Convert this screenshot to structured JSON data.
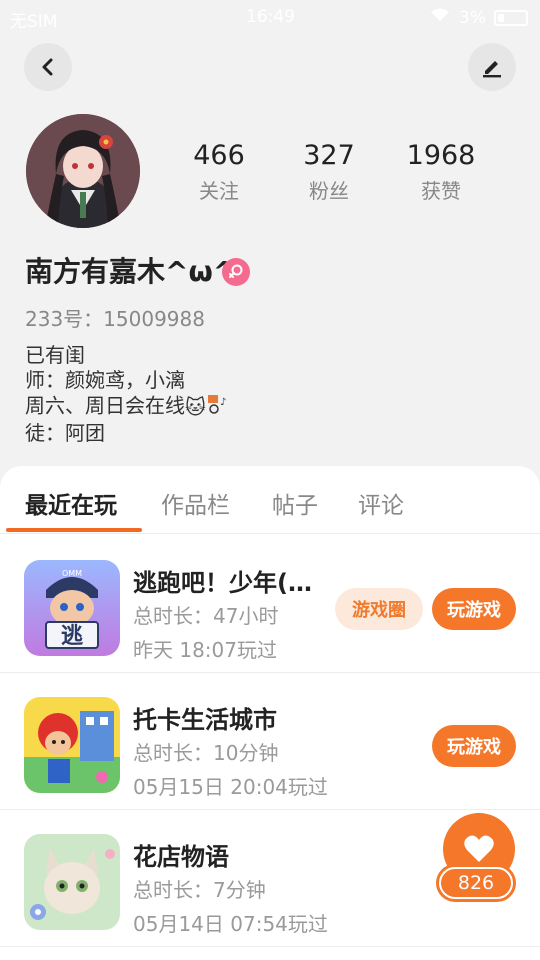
{
  "status_bar": {
    "carrier": "无SIM",
    "time": "16:49",
    "battery": "3%"
  },
  "header": {
    "back_icon": "chevron-left-icon",
    "edit_icon": "edit-pen-icon"
  },
  "profile": {
    "stats": [
      {
        "value": "466",
        "label": "关注"
      },
      {
        "value": "327",
        "label": "粉丝"
      },
      {
        "value": "1968",
        "label": "获赞"
      }
    ],
    "nickname": "南方有嘉木^ω^",
    "gender": "female",
    "uid_text": "233号：15009988",
    "bio_lines": [
      "已有闺",
      "师：颜婉鸢，小漓",
      "周六、周日会在线",
      "徒：阿团"
    ],
    "bio_emoji": "🐱"
  },
  "tabs": [
    {
      "label": "最近在玩",
      "active": true
    },
    {
      "label": "作品栏",
      "active": false
    },
    {
      "label": "帖子",
      "active": false
    },
    {
      "label": "评论",
      "active": false
    }
  ],
  "games": [
    {
      "name": "逃跑吧！少年(…",
      "duration": "总时长：47小时",
      "last_played": "昨天 18:07玩过",
      "circle_label": "游戏圈",
      "play_label": "玩游戏",
      "icon_text": "逃",
      "icon_cap": "OMM"
    },
    {
      "name": "托卡生活城市",
      "duration": "总时长：10分钟",
      "last_played": "05月15日 20:04玩过",
      "play_label": "玩游戏"
    },
    {
      "name": "花店物语",
      "duration": "总时长：7分钟",
      "last_played": "05月14日 07:54玩过"
    }
  ],
  "like_fab": {
    "icon": "heart-icon",
    "count": "826"
  },
  "colors": {
    "accent": "#f4772a",
    "accent_light": "#fde9db",
    "female_badge": "#f56a8f"
  }
}
